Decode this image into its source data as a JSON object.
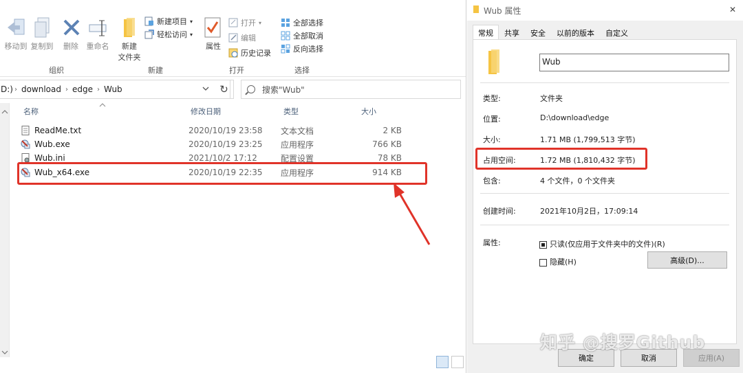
{
  "explorer": {
    "window_controls": {
      "minimize": "—",
      "expand": "∨",
      "help": "?"
    },
    "ribbon": {
      "organize": {
        "move_to": "移动到",
        "copy_to": "复制到",
        "delete": "删除",
        "rename": "重命名",
        "group_label": "组织"
      },
      "new": {
        "new_folder_line1": "新建",
        "new_folder_line2": "文件夹",
        "new_item": "新建项目",
        "easy_access": "轻松访问",
        "group_label": "新建"
      },
      "open": {
        "properties": "属性",
        "open": "打开",
        "edit": "编辑",
        "history": "历史记录",
        "group_label": "打开"
      },
      "select": {
        "select_all": "全部选择",
        "select_none": "全部取消",
        "invert": "反向选择",
        "group_label": "选择"
      }
    },
    "address": {
      "drive": "D:)",
      "path": [
        "download",
        "edge",
        "Wub"
      ]
    },
    "search_placeholder": "搜索\"Wub\"",
    "columns": {
      "name": "名称",
      "date": "修改日期",
      "type": "类型",
      "size": "大小"
    },
    "files": [
      {
        "name": "ReadMe.txt",
        "date": "2020/10/19 23:58",
        "type": "文本文档",
        "size": "2 KB",
        "icon": "text-file-icon"
      },
      {
        "name": "Wub.exe",
        "date": "2020/10/19 23:25",
        "type": "应用程序",
        "size": "766 KB",
        "icon": "exe-file-icon"
      },
      {
        "name": "Wub.ini",
        "date": "2021/10/2 17:12",
        "type": "配置设置",
        "size": "78 KB",
        "icon": "ini-file-icon"
      },
      {
        "name": "Wub_x64.exe",
        "date": "2020/10/19 22:35",
        "type": "应用程序",
        "size": "914 KB",
        "icon": "exe-file-icon"
      }
    ]
  },
  "props": {
    "title": "Wub 属性",
    "tabs": [
      "常规",
      "共享",
      "安全",
      "以前的版本",
      "自定义"
    ],
    "name_value": "Wub",
    "type_label": "类型:",
    "type_value": "文件夹",
    "location_label": "位置:",
    "location_value": "D:\\download\\edge",
    "size_label": "大小:",
    "size_value": "1.71 MB (1,799,513 字节)",
    "disk_label": "占用空间:",
    "disk_value": "1.72 MB (1,810,432 字节)",
    "contains_label": "包含:",
    "contains_value": "4 个文件，0 个文件夹",
    "created_label": "创建时间:",
    "created_value": "2021年10月2日，17:09:14",
    "attributes_label": "属性:",
    "readonly_label": "只读(仅应用于文件夹中的文件)(R)",
    "hidden_label": "隐藏(H)",
    "advanced_button": "高级(D)...",
    "ok": "确定",
    "cancel": "取消",
    "apply": "应用(A)",
    "close_glyph": "✕"
  },
  "watermark": "知乎 @搜罗Github",
  "colors": {
    "highlight": "#e03329",
    "folder": "#f5c443",
    "accent": "#1a73c8"
  }
}
